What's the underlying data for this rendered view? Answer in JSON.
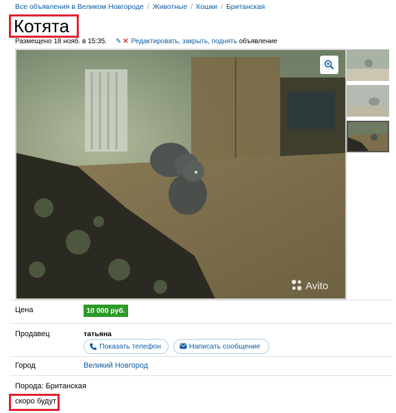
{
  "breadcrumbs": [
    {
      "label": "Все объявления в Великом Новгороде"
    },
    {
      "label": "Животные"
    },
    {
      "label": "Кошки"
    },
    {
      "label": "Британская"
    }
  ],
  "breadcrumb_separator": "/",
  "listing": {
    "title": "Котята",
    "posted": "Размещено 18 нояб. в 15:35.",
    "edit_link": "Редактировать, закрыть, поднять",
    "edit_suffix": "объявление",
    "watermark": "Avito"
  },
  "details": {
    "price_label": "Цена",
    "price_value": "10 000 руб.",
    "seller_label": "Продавец",
    "seller_name": "татьяна",
    "show_phone_button": "Показать телефон",
    "write_message_button": "Написать сообщение",
    "city_label": "Город",
    "city_value": "Великий Новгород",
    "breed": "Порода: Британская",
    "description": "скоро будут"
  },
  "colors": {
    "link": "#0b5aa5",
    "price_badge": "#2b9a28",
    "highlight": "#e02030"
  },
  "icons": [
    "zoom-in-icon",
    "pencil-icon",
    "close-icon",
    "phone-icon",
    "envelope-icon",
    "avito-logo-icon"
  ]
}
